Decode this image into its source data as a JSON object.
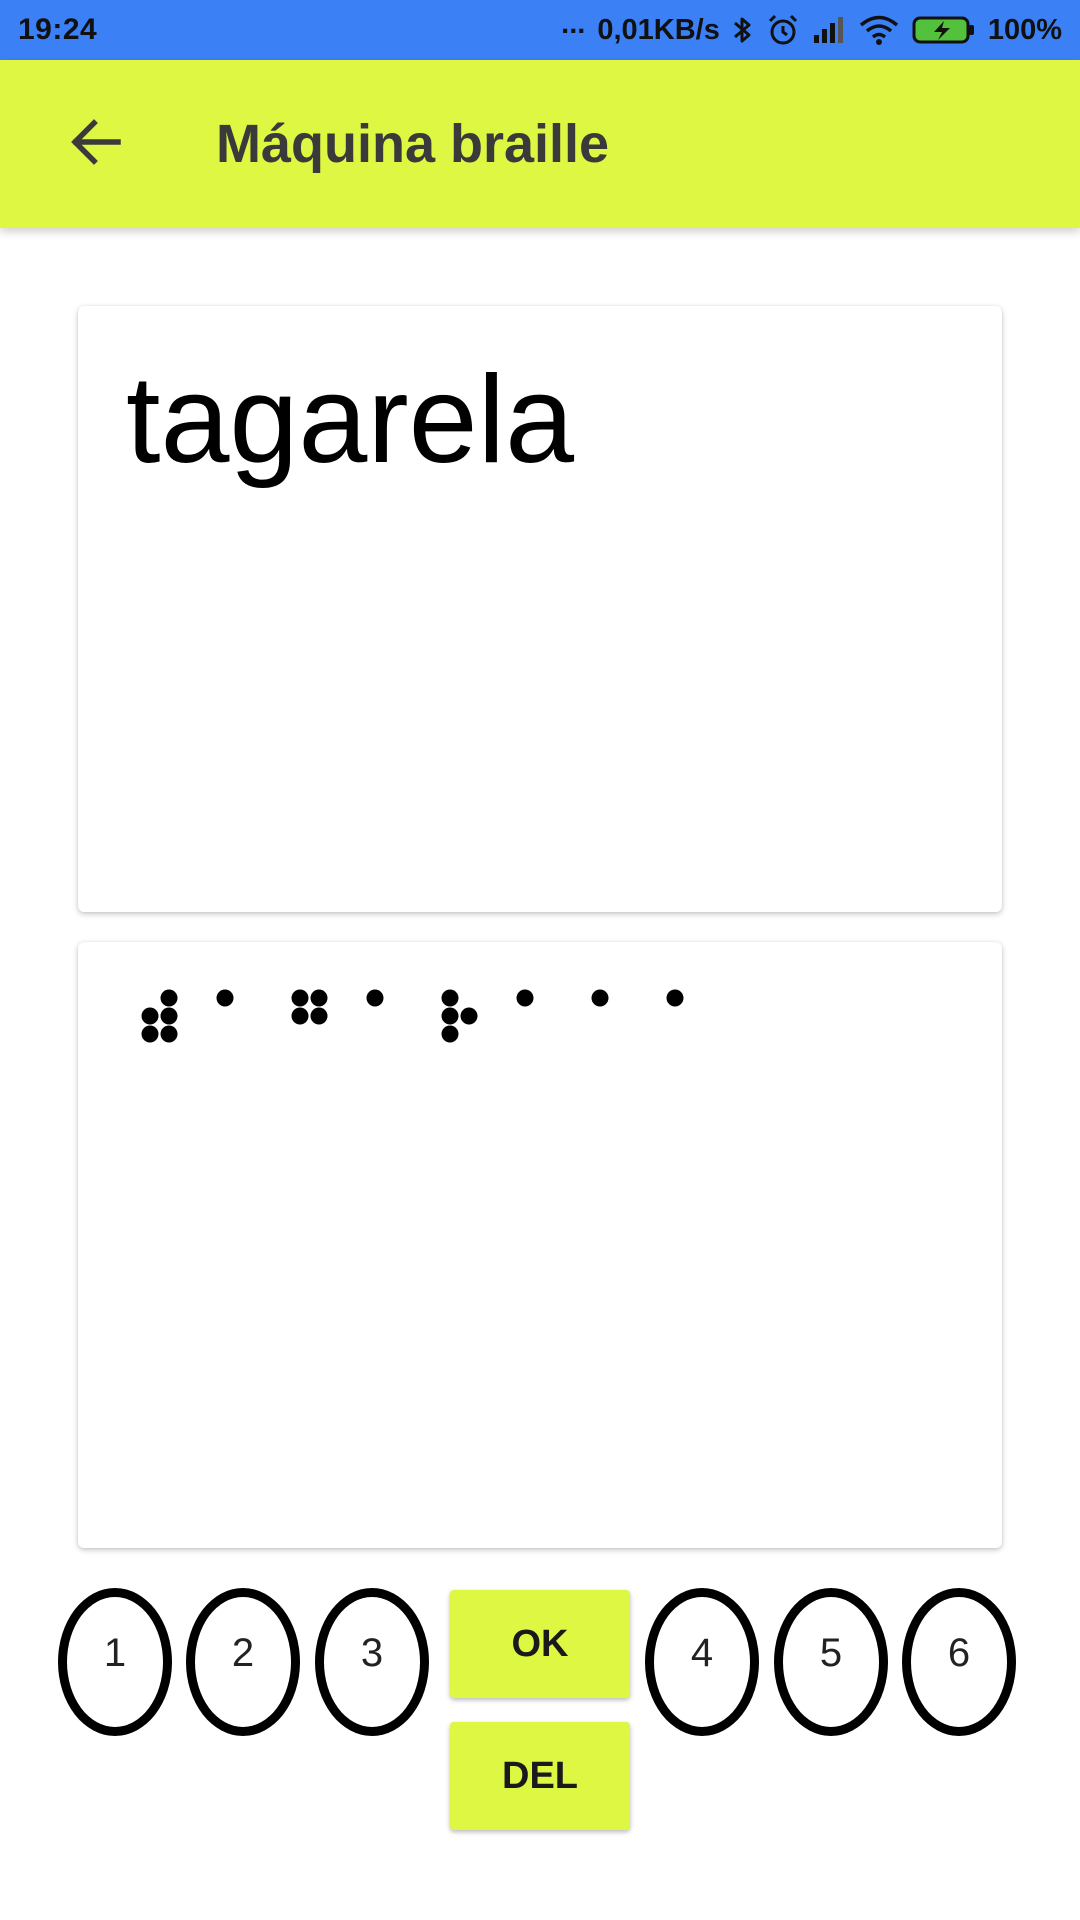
{
  "status_bar": {
    "time": "19:24",
    "dots": "...",
    "network_speed": "0,01KB/s",
    "battery_percent": "100%",
    "icons": [
      "bluetooth-icon",
      "alarm-icon",
      "signal-icon",
      "wifi-icon",
      "battery-charging-icon"
    ]
  },
  "app_bar": {
    "title": "Máquina braille",
    "back_icon": "arrow-back-icon"
  },
  "text_card": {
    "text": "tagarela"
  },
  "braille_card": {
    "cells": [
      [
        2,
        3,
        4,
        5,
        6
      ],
      [
        1
      ],
      [
        1,
        2,
        4,
        5
      ],
      [
        1
      ],
      [
        1,
        2,
        3,
        5
      ],
      [
        1
      ],
      [
        1
      ],
      [
        1
      ]
    ]
  },
  "keyboard": {
    "dot_keys": [
      "1",
      "2",
      "3",
      "4",
      "5",
      "6"
    ],
    "ok_label": "OK",
    "del_label": "DEL"
  },
  "colors": {
    "status_bar": "#3b80f5",
    "accent": "#ddf742",
    "title_text": "#3a3a3a"
  }
}
